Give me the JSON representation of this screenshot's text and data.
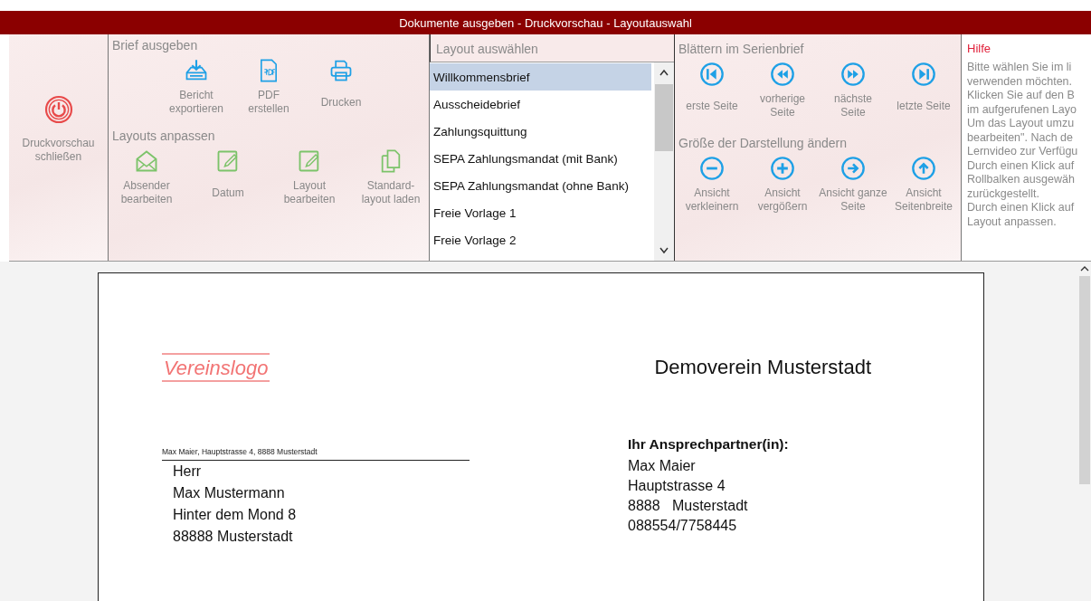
{
  "window": {
    "title": "Dokumente ausgeben - Druckvorschau  -  Layoutauswahl"
  },
  "close_button": {
    "label": "Druckvorschau schließen",
    "kind": "power"
  },
  "output_group": {
    "heading": "Brief ausgeben",
    "buttons": [
      {
        "label": "Bericht exportieren",
        "kind": "export"
      },
      {
        "label": "PDF erstellen",
        "kind": "pdf"
      },
      {
        "label": "Drucken",
        "kind": "print"
      }
    ]
  },
  "layout_group": {
    "heading": "Layouts anpassen",
    "buttons": [
      {
        "label": "Absender bearbeiten",
        "kind": "envelope"
      },
      {
        "label": "Datum",
        "kind": "edit"
      },
      {
        "label": "Layout bearbeiten",
        "kind": "edit"
      },
      {
        "label": "Standard-layout laden",
        "kind": "copy"
      }
    ]
  },
  "layout_list": {
    "heading": "Layout auswählen",
    "items": [
      {
        "label": "Willkommensbrief",
        "selected": true
      },
      {
        "label": "Ausscheidebrief",
        "selected": false
      },
      {
        "label": "Zahlungsquittung",
        "selected": false
      },
      {
        "label": "SEPA Zahlungsmandat (mit Bank)",
        "selected": false
      },
      {
        "label": "SEPA Zahlungsmandat (ohne Bank)",
        "selected": false
      },
      {
        "label": "Freie Vorlage 1",
        "selected": false
      },
      {
        "label": "Freie Vorlage 2",
        "selected": false
      }
    ]
  },
  "paging_group": {
    "heading": "Blättern im Serienbrief",
    "buttons": [
      {
        "label": "erste Seite",
        "kind": "first"
      },
      {
        "label": "vorherige Seite",
        "kind": "prev"
      },
      {
        "label": "nächste Seite",
        "kind": "next"
      },
      {
        "label": "letzte Seite",
        "kind": "last"
      }
    ]
  },
  "zoom_group": {
    "heading": "Größe der Darstellung ändern",
    "buttons": [
      {
        "label": "Ansicht verkleinern",
        "kind": "minus"
      },
      {
        "label": "Ansicht vergößern",
        "kind": "plus"
      },
      {
        "label": "Ansicht ganze Seite",
        "kind": "right"
      },
      {
        "label": "Ansicht Seitenbreite",
        "kind": "up"
      }
    ]
  },
  "help": {
    "heading": "Hilfe",
    "lines": [
      "Bitte wählen Sie im li",
      "verwenden möchten.",
      "Klicken Sie auf den B",
      "im aufgerufenen Layo",
      "Um das Layout umzu",
      "bearbeiten\". Nach de",
      "Lernvideo zur Verfügu",
      "Durch einen Klick auf",
      "Rollbalken ausgewäh",
      "zurückgestellt.",
      "Durch einen Klick auf",
      "Layout anpassen."
    ]
  },
  "document": {
    "logo": "Vereinslogo",
    "organization": "Demoverein Musterstadt",
    "sender_line": "Max Maier, Hauptstrasse 4, 8888 Musterstadt",
    "recipient": [
      "Herr",
      "Max Mustermann",
      "Hinter dem Mond 8",
      "88888 Musterstadt"
    ],
    "contact_heading": "Ihr Ansprechpartner(in):",
    "contact": [
      "Max Maier",
      "Hauptstrasse 4",
      "8888   Musterstadt",
      "088554/7758445"
    ]
  }
}
